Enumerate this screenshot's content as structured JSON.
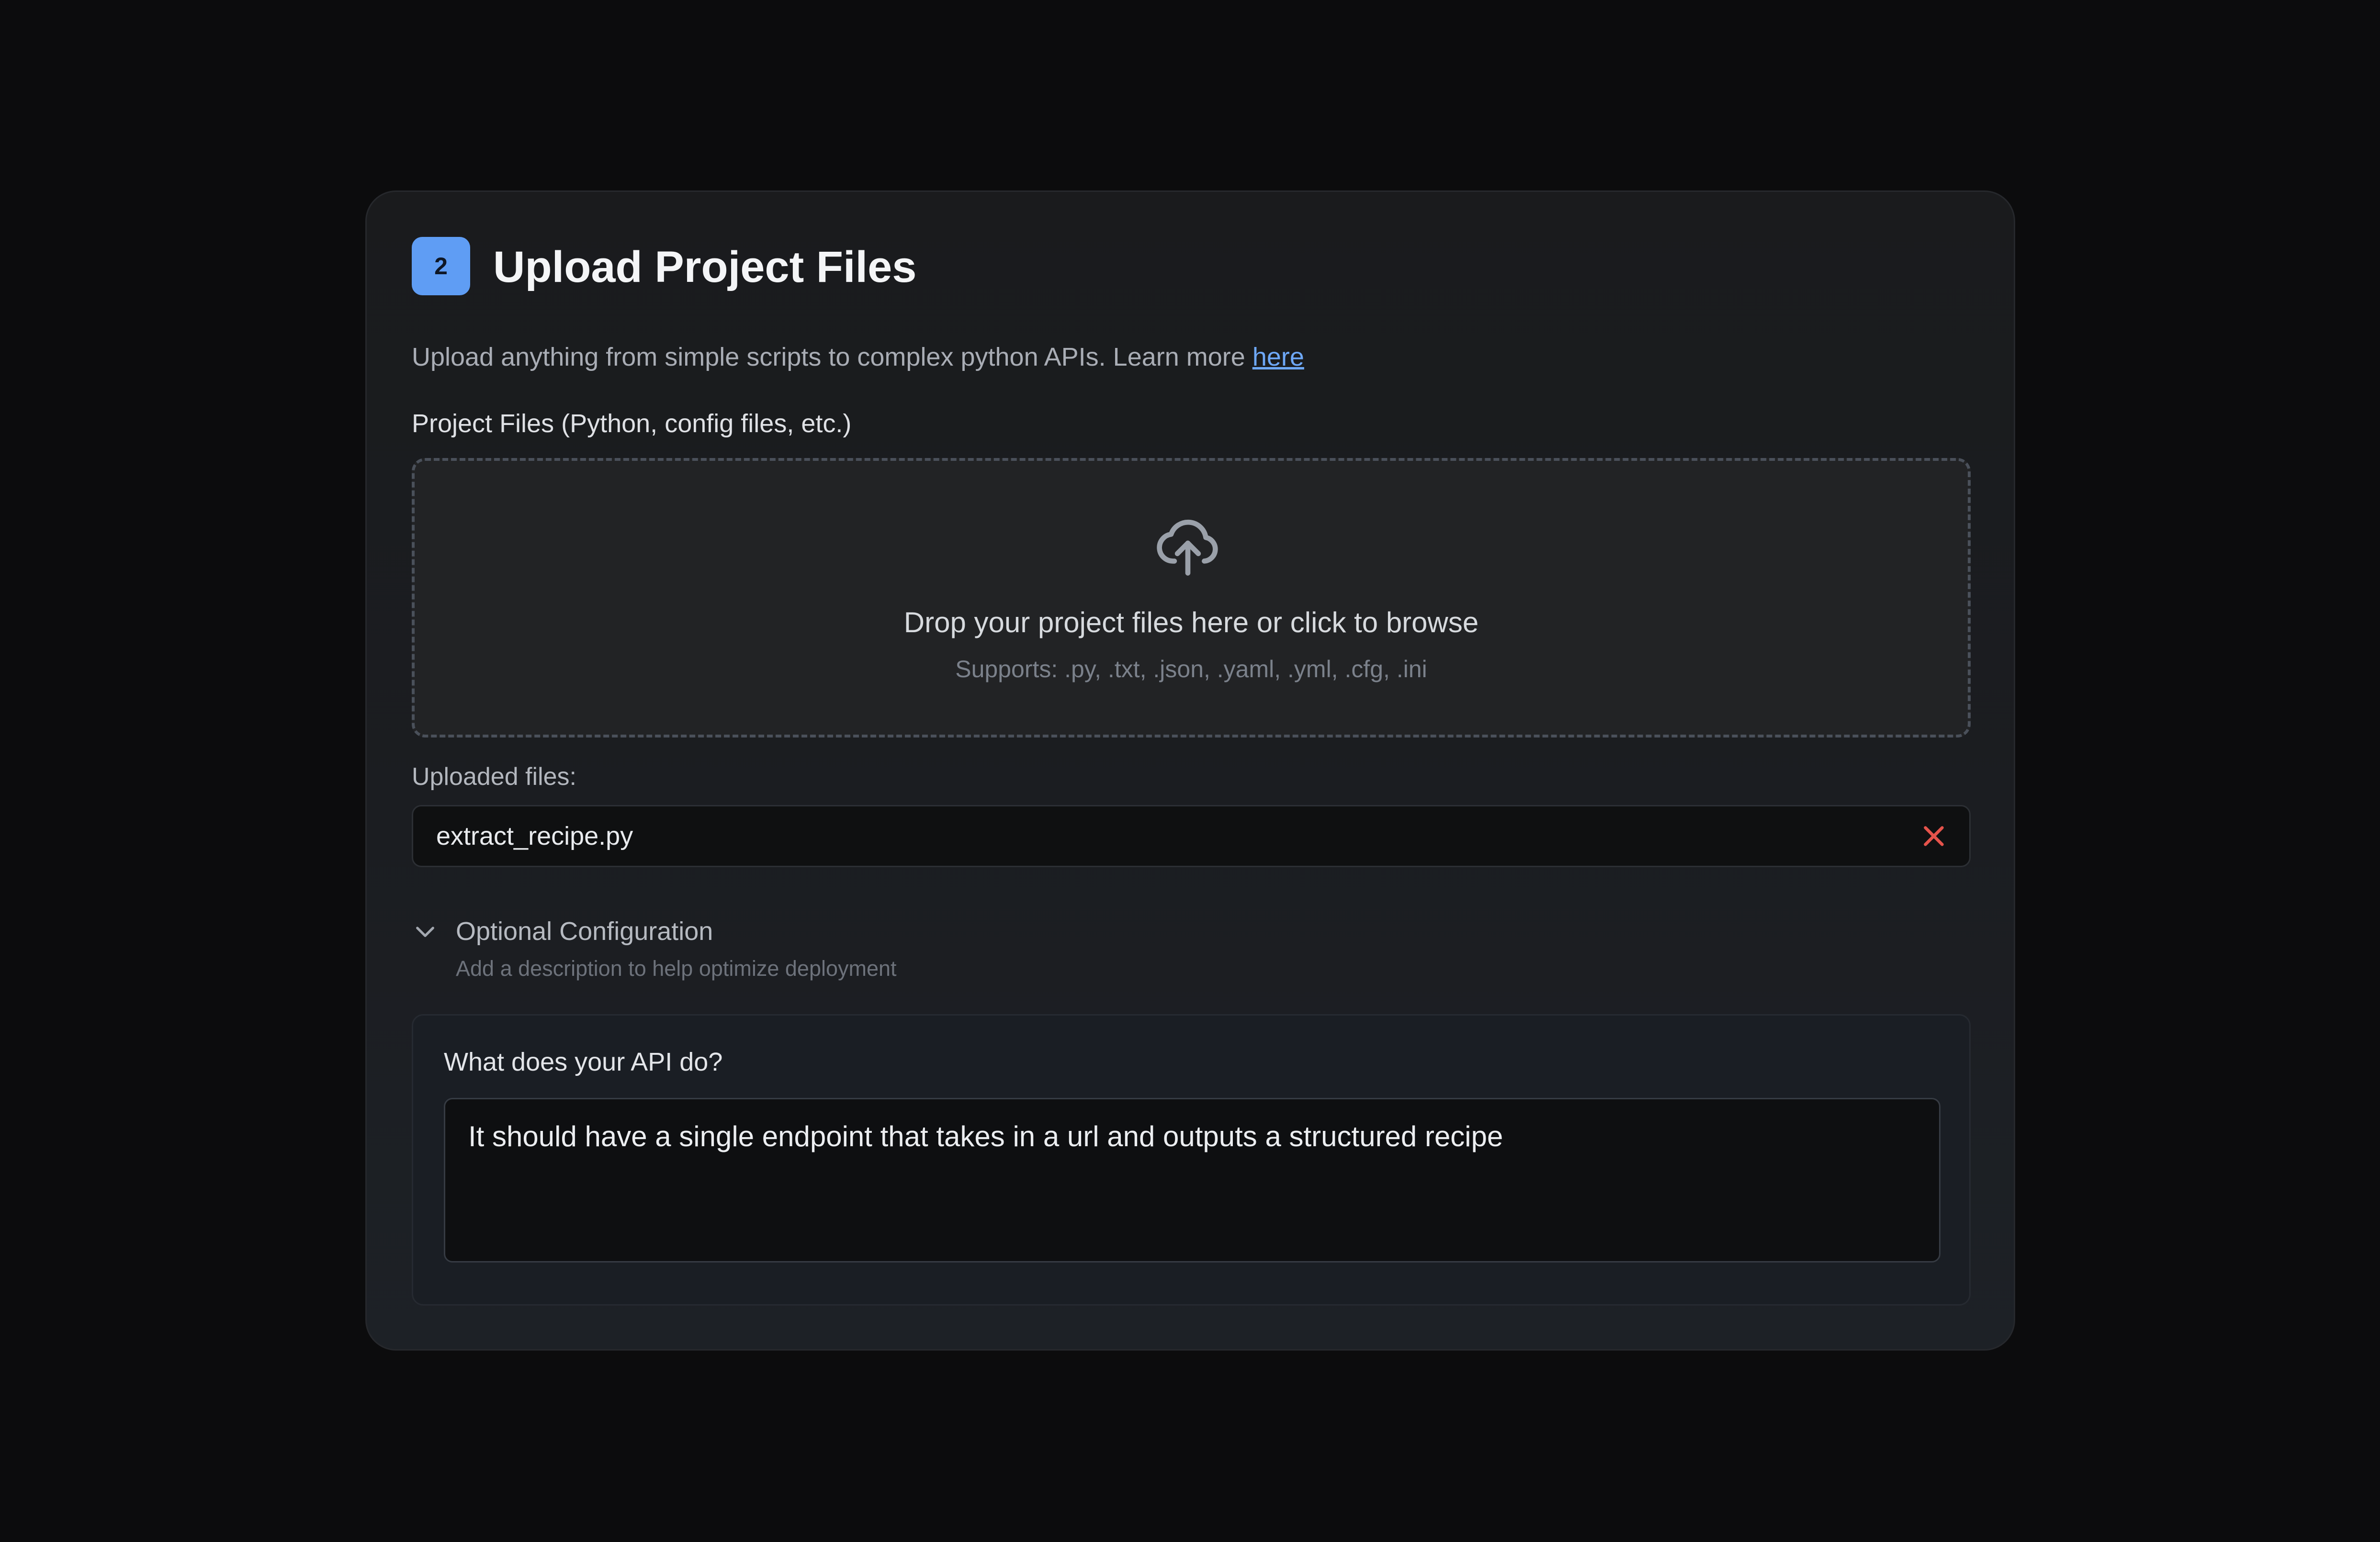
{
  "step": {
    "number": "2",
    "title": "Upload Project Files"
  },
  "intro": {
    "text": "Upload anything from simple scripts to complex python APIs. Learn more ",
    "link_label": "here"
  },
  "project_files": {
    "label": "Project Files (Python, config files, etc.)"
  },
  "dropzone": {
    "icon": "cloud-upload-icon",
    "prompt": "Drop your project files here or click to browse",
    "supports": "Supports: .py, .txt, .json, .yaml, .yml, .cfg, .ini"
  },
  "uploaded": {
    "label": "Uploaded files:",
    "files": [
      {
        "name": "extract_recipe.py"
      }
    ]
  },
  "optional_config": {
    "title": "Optional Configuration",
    "subtitle": "Add a description to help optimize deployment",
    "question": "What does your API do?",
    "description": "It should have a single endpoint that takes in a url and outputs a structured recipe"
  },
  "colors": {
    "accent": "#5f9df4",
    "link": "#6ea8f7",
    "remove": "#e5534b",
    "background": "#0c0c0d"
  }
}
